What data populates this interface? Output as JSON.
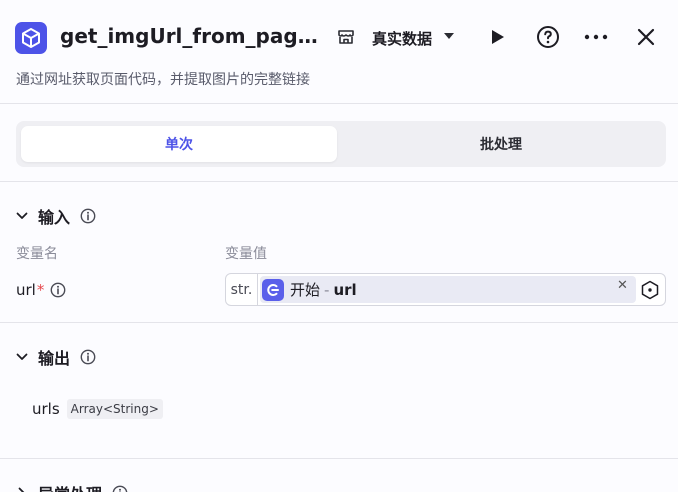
{
  "node": {
    "title": "get_imgUrl_from_page…",
    "description": "通过网址获取页面代码，并提取图片的完整链接"
  },
  "toolbar": {
    "env_label": "真实数据"
  },
  "tabs": [
    {
      "label": "单次",
      "active": true
    },
    {
      "label": "批处理",
      "active": false
    }
  ],
  "input_section": {
    "title": "输入",
    "col_name": "变量名",
    "col_value": "变量值",
    "params": [
      {
        "name": "url",
        "required_mark": "*",
        "type": "str.",
        "ref_node": "开始",
        "ref_sep": "-",
        "ref_var": "url"
      }
    ]
  },
  "output_section": {
    "title": "输出",
    "outputs": [
      {
        "name": "urls",
        "type": "Array<String>"
      }
    ]
  },
  "error_section": {
    "title": "异常处理"
  },
  "colors": {
    "accent": "#4d53e8",
    "required": "#e5484d"
  }
}
